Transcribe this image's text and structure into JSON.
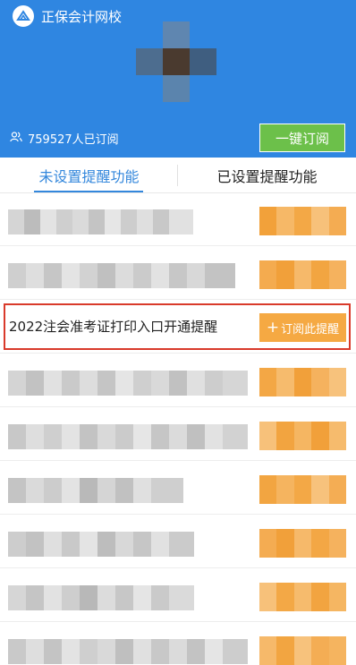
{
  "header": {
    "brand": "正保会计网校",
    "subscriber_count": "759527人已订阅",
    "subscribe_all_label": "一键订阅"
  },
  "tabs": [
    {
      "label": "未设置提醒功能",
      "active": true
    },
    {
      "label": "已设置提醒功能",
      "active": false
    }
  ],
  "reminders": {
    "highlighted_item": {
      "title": "2022注会准考证打印入口开通提醒",
      "button_label": "+订阅此提醒",
      "button_plus": "+",
      "button_text": "订阅此提醒"
    }
  },
  "colors": {
    "header_bg": "#2f86e1",
    "subscribe_all_bg": "#6cc04a",
    "subscribe_btn_bg": "#f5a943",
    "tab_active": "#3387dc",
    "highlight_border": "#d93a2b"
  },
  "icons": [
    "logo-icon",
    "users-icon",
    "plus-icon"
  ]
}
